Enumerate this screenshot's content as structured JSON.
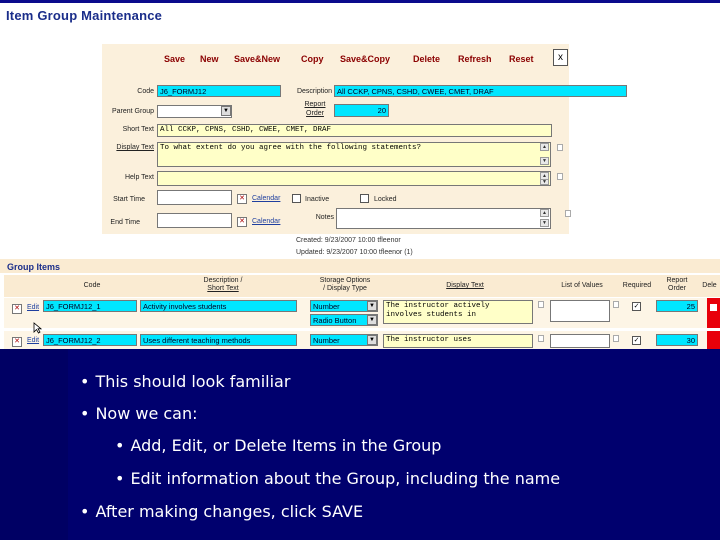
{
  "title": "Item Group Maintenance",
  "toolbar": {
    "save": "Save",
    "new": "New",
    "save_new": "Save&New",
    "copy": "Copy",
    "save_copy": "Save&Copy",
    "delete": "Delete",
    "refresh": "Refresh",
    "reset": "Reset",
    "close": "x"
  },
  "form": {
    "code_label": "Code",
    "code_value": "J6_FORMJ12",
    "description_label": "Description",
    "description_value": "All CCKP, CPNS, CSHD, CWEE, CMET, DRAF",
    "parent_group_label": "Parent Group",
    "report_order_label_1": "Report",
    "report_order_label_2": "Order",
    "report_order_value": "20",
    "short_text_label": "Short Text",
    "short_text_value": "All CCKP, CPNS, CSHD, CWEE, CMET, DRAF",
    "display_text_label": "Display Text",
    "display_text_value": "To what extent do you agree with the following statements?",
    "help_text_label": "Help Text",
    "start_time_label": "Start Time",
    "end_time_label": "End Time",
    "calendar_link": "Calendar",
    "inactive_label": "Inactive",
    "locked_label": "Locked",
    "notes_label": "Notes",
    "created": "Created: 9/23/2007 10:00 tfleenor",
    "updated": "Updated: 9/23/2007 10:00 tfleenor (1)"
  },
  "group_items": {
    "title": "Group Items",
    "columns": {
      "code": "Code",
      "description_1": "Description /",
      "description_2": "Short Text",
      "storage_1": "Storage Options",
      "storage_2": "/ Display Type",
      "display_text": "Display Text",
      "list_of_values": "List of Values",
      "required": "Required",
      "report_order_1": "Report",
      "report_order_2": "Order",
      "delete": "Dele"
    },
    "rows": [
      {
        "edit": "Edit",
        "code": "J6_FORMJ12_1",
        "description": "Activity involves students",
        "storage": "Number",
        "display_type": "Radio Button",
        "display_text": "The instructor actively involves students in",
        "report_order": "25"
      },
      {
        "edit": "Edit",
        "code": "J6_FORMJ12_2",
        "description": "Uses different teaching methods",
        "storage": "Number",
        "display_text": "The instructor uses",
        "report_order": "30"
      }
    ]
  },
  "bullets": [
    "This should look familiar",
    "Now we can:",
    "Add, Edit, or Delete Items in the Group",
    "Edit information about the Group, including the name",
    "After making changes, click SAVE"
  ],
  "icons": {
    "dropdown": "chevron-down-icon",
    "close": "close-icon",
    "calendar": "calendar-icon",
    "delete_row": "delete-row-icon",
    "cursor": "cursor-icon"
  },
  "colors": {
    "title": "#1a2d8a",
    "toolbar_button": "#8b0000",
    "input_highlight": "#00e6ff",
    "textarea": "#ffffc8",
    "form_background": "#fbf0dc",
    "slide_background": "#00006e",
    "delete_column": "#e8000a"
  }
}
